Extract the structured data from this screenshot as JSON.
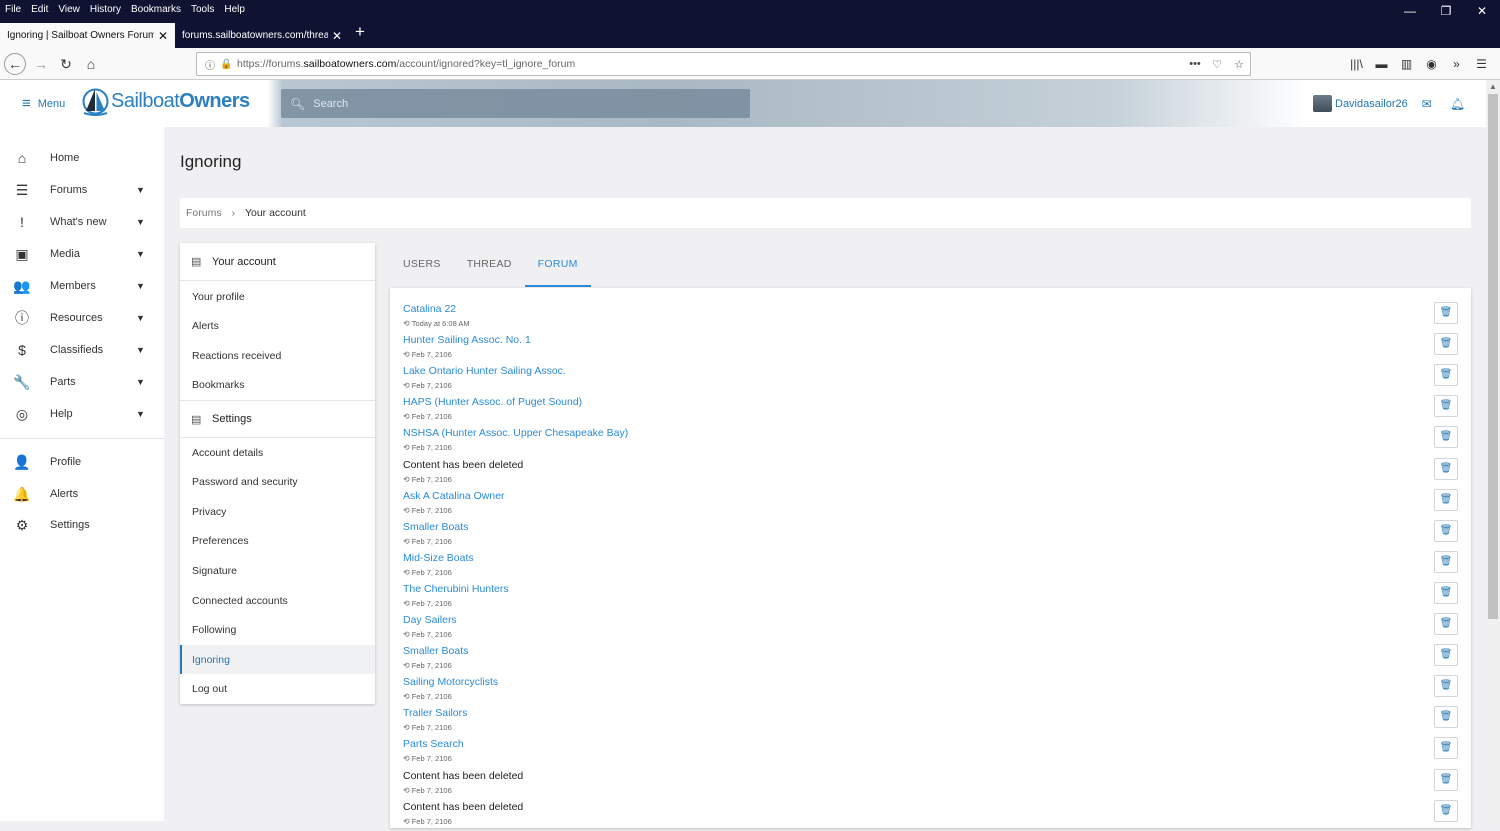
{
  "browser": {
    "menu": [
      "File",
      "Edit",
      "View",
      "History",
      "Bookmarks",
      "Tools",
      "Help"
    ],
    "window_controls": [
      "—",
      "❐",
      "✕"
    ],
    "tabs": [
      {
        "label": "Ignoring | Sailboat Owners Forums"
      },
      {
        "label": "forums.sailboatowners.com/thread"
      }
    ],
    "new_tab": "+",
    "url_prefix": "https://forums.",
    "url_domain": "sailboatowners.com",
    "url_path": "/account/ignored?key=tl_ignore_forum"
  },
  "header": {
    "menu_label": "Menu",
    "logo_part1": "Sailboat",
    "logo_part2": "Owners",
    "search_placeholder": "Search",
    "username": "Davidasailor26"
  },
  "leftnav": {
    "items": [
      {
        "label": "Home",
        "icon": "home-icon",
        "glyph": "⌂",
        "chevron": false
      },
      {
        "label": "Forums",
        "icon": "forums-icon",
        "glyph": "☰",
        "chevron": true
      },
      {
        "label": "What's new",
        "icon": "whats-new-icon",
        "glyph": "!",
        "chevron": true
      },
      {
        "label": "Media",
        "icon": "media-icon",
        "glyph": "▣",
        "chevron": true
      },
      {
        "label": "Members",
        "icon": "members-icon",
        "glyph": "👥",
        "chevron": true
      },
      {
        "label": "Resources",
        "icon": "resources-icon",
        "glyph": "ⓘ",
        "chevron": true
      },
      {
        "label": "Classifieds",
        "icon": "classifieds-icon",
        "glyph": "$",
        "chevron": true
      },
      {
        "label": "Parts",
        "icon": "parts-icon",
        "glyph": "🔧",
        "chevron": true
      },
      {
        "label": "Help",
        "icon": "help-icon",
        "glyph": "◎",
        "chevron": true
      }
    ],
    "user_items": [
      {
        "label": "Profile",
        "icon": "profile-icon",
        "glyph": "👤"
      },
      {
        "label": "Alerts",
        "icon": "alerts-icon",
        "glyph": "🔔"
      },
      {
        "label": "Settings",
        "icon": "settings-icon",
        "glyph": "⚙"
      }
    ]
  },
  "main": {
    "title": "Ignoring",
    "breadcrumb": [
      "Forums",
      "Your account"
    ]
  },
  "account_panel": {
    "your_account_header": "Your account",
    "your_account_items": [
      "Your profile",
      "Alerts",
      "Reactions received",
      "Bookmarks"
    ],
    "settings_header": "Settings",
    "settings_items": [
      "Account details",
      "Password and security",
      "Privacy",
      "Preferences",
      "Signature",
      "Connected accounts",
      "Following",
      "Ignoring",
      "Log out"
    ],
    "selected": "Ignoring"
  },
  "ignore_tabs": [
    "USERS",
    "THREAD",
    "FORUM"
  ],
  "active_tab": "FORUM",
  "ignored_forums": [
    {
      "title": "Catalina 22",
      "date": "Today at 6:08 AM",
      "deleted": false
    },
    {
      "title": "Hunter Sailing Assoc. No. 1",
      "date": "Feb 7, 2106",
      "deleted": false
    },
    {
      "title": "Lake Ontario Hunter Sailing Assoc.",
      "date": "Feb 7, 2106",
      "deleted": false
    },
    {
      "title": "HAPS (Hunter Assoc. of Puget Sound)",
      "date": "Feb 7, 2106",
      "deleted": false
    },
    {
      "title": "NSHSA (Hunter Assoc. Upper Chesapeake Bay)",
      "date": "Feb 7, 2106",
      "deleted": false
    },
    {
      "title": "Content has been deleted",
      "date": "Feb 7, 2106",
      "deleted": true
    },
    {
      "title": "Ask A Catalina Owner",
      "date": "Feb 7, 2106",
      "deleted": false
    },
    {
      "title": "Smaller Boats",
      "date": "Feb 7, 2106",
      "deleted": false
    },
    {
      "title": "Mid-Size Boats",
      "date": "Feb 7, 2106",
      "deleted": false
    },
    {
      "title": "The Cherubini Hunters",
      "date": "Feb 7, 2106",
      "deleted": false
    },
    {
      "title": "Day Sailers",
      "date": "Feb 7, 2106",
      "deleted": false
    },
    {
      "title": "Smaller Boats",
      "date": "Feb 7, 2106",
      "deleted": false
    },
    {
      "title": "Sailing Motorcyclists",
      "date": "Feb 7, 2106",
      "deleted": false
    },
    {
      "title": "Trailer Sailors",
      "date": "Feb 7, 2106",
      "deleted": false
    },
    {
      "title": "Parts Search",
      "date": "Feb 7, 2106",
      "deleted": false
    },
    {
      "title": "Content has been deleted",
      "date": "Feb 7, 2106",
      "deleted": true
    },
    {
      "title": "Content has been deleted",
      "date": "Feb 7, 2106",
      "deleted": true
    }
  ],
  "colors": {
    "accent": "#2b8bd8",
    "link": "#2577b1",
    "chrome_dark": "#0f1231"
  }
}
